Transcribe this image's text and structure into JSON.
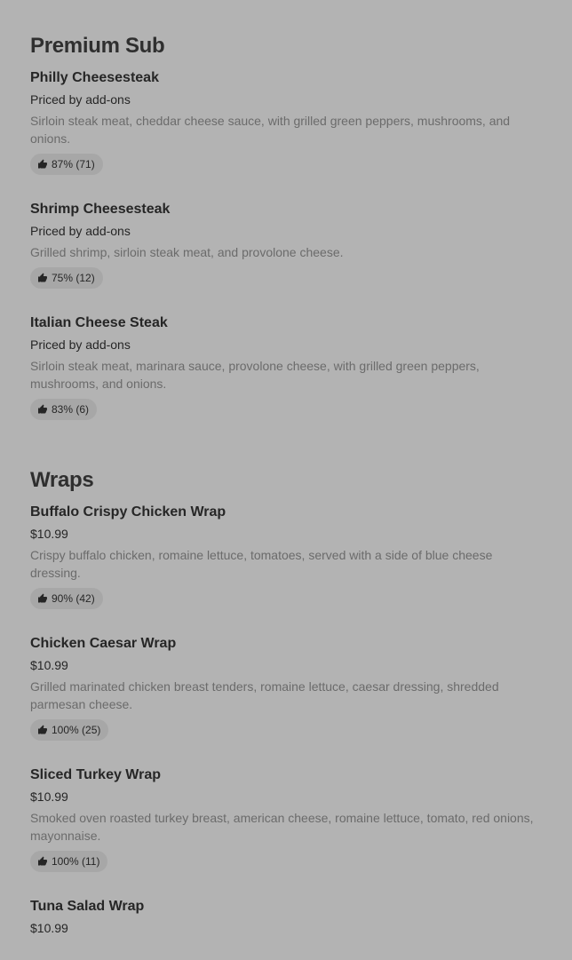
{
  "sections": [
    {
      "title": "Premium Sub",
      "items": [
        {
          "name": "Philly Cheesesteak",
          "price": "Priced by add-ons",
          "description": "Sirloin steak meat, cheddar cheese sauce, with grilled green peppers, mushrooms, and onions.",
          "rating": "87% (71)"
        },
        {
          "name": "Shrimp Cheesesteak",
          "price": "Priced by add-ons",
          "description": "Grilled shrimp, sirloin steak meat, and provolone cheese.",
          "rating": "75% (12)"
        },
        {
          "name": "Italian Cheese Steak",
          "price": "Priced by add-ons",
          "description": "Sirloin steak meat, marinara sauce, provolone cheese, with grilled green peppers, mushrooms, and onions.",
          "rating": "83% (6)"
        }
      ]
    },
    {
      "title": "Wraps",
      "items": [
        {
          "name": "Buffalo Crispy Chicken Wrap",
          "price": "$10.99",
          "description": "Crispy buffalo chicken, romaine lettuce, tomatoes, served with a side of blue cheese dressing.",
          "rating": "90% (42)"
        },
        {
          "name": "Chicken Caesar Wrap",
          "price": "$10.99",
          "description": "Grilled marinated chicken breast tenders, romaine lettuce, caesar dressing, shredded parmesan cheese.",
          "rating": "100% (25)"
        },
        {
          "name": "Sliced Turkey Wrap",
          "price": "$10.99",
          "description": "Smoked oven roasted turkey breast, american cheese, romaine lettuce, tomato, red onions, mayonnaise.",
          "rating": "100% (11)"
        },
        {
          "name": "Tuna Salad Wrap",
          "price": "$10.99"
        }
      ]
    }
  ],
  "icons": {
    "rating": "thumbs-up-icon"
  },
  "colors": {
    "background": "#b3b3b3",
    "badge": "#a7a7a7",
    "description": "#6b6b6b"
  }
}
